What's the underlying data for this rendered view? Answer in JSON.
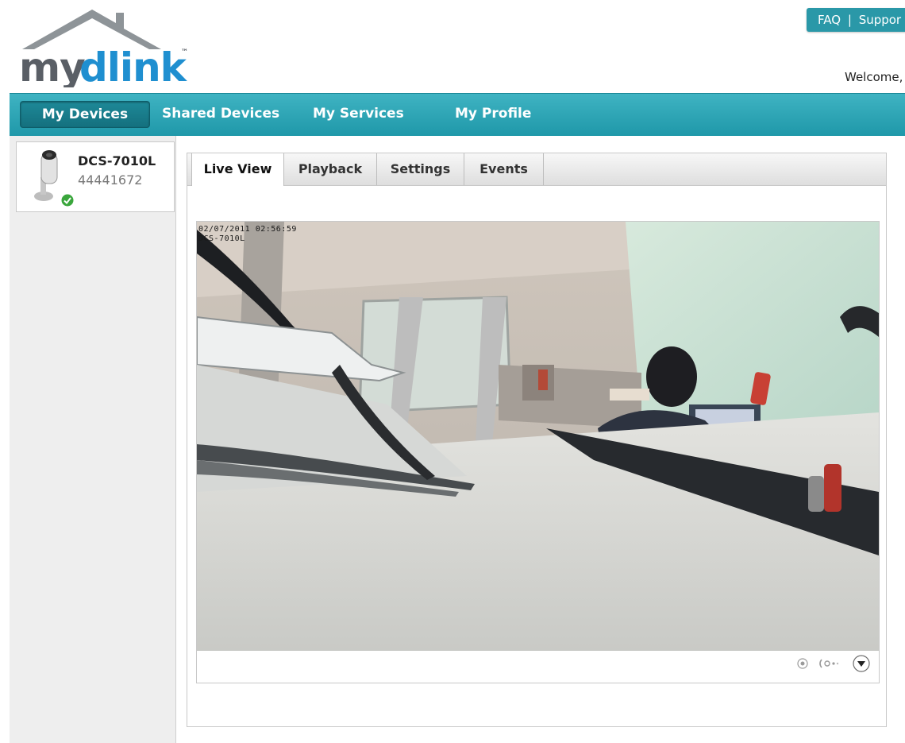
{
  "header": {
    "logo_text": "mydlink",
    "logo_tm": "™",
    "faq_label": "FAQ",
    "separator": "|",
    "support_label": "Suppor",
    "welcome_text": "Welcome,"
  },
  "nav": {
    "items": [
      {
        "label": "My Devices",
        "active": true
      },
      {
        "label": "Shared Devices",
        "active": false
      },
      {
        "label": "My Services",
        "active": false
      },
      {
        "label": "My Profile",
        "active": false
      }
    ]
  },
  "sidebar": {
    "device": {
      "name": "DCS-7010L",
      "id": "44441672",
      "status": "online",
      "icon": "camera-icon",
      "status_icon": "check-icon"
    }
  },
  "tabs": [
    {
      "label": "Live View",
      "active": true
    },
    {
      "label": "Playback",
      "active": false
    },
    {
      "label": "Settings",
      "active": false
    },
    {
      "label": "Events",
      "active": false
    }
  ],
  "viewer": {
    "osd_timestamp": "02/07/2011 02:56:59",
    "osd_camera": "DCS-7010L",
    "controls": [
      "record-icon",
      "audio-icon",
      "expand-down-icon"
    ]
  },
  "colors": {
    "accent": "#2a98a8",
    "logo_blue": "#1f8fd0",
    "logo_gray": "#5a5f66",
    "status_green": "#3aa63c"
  }
}
